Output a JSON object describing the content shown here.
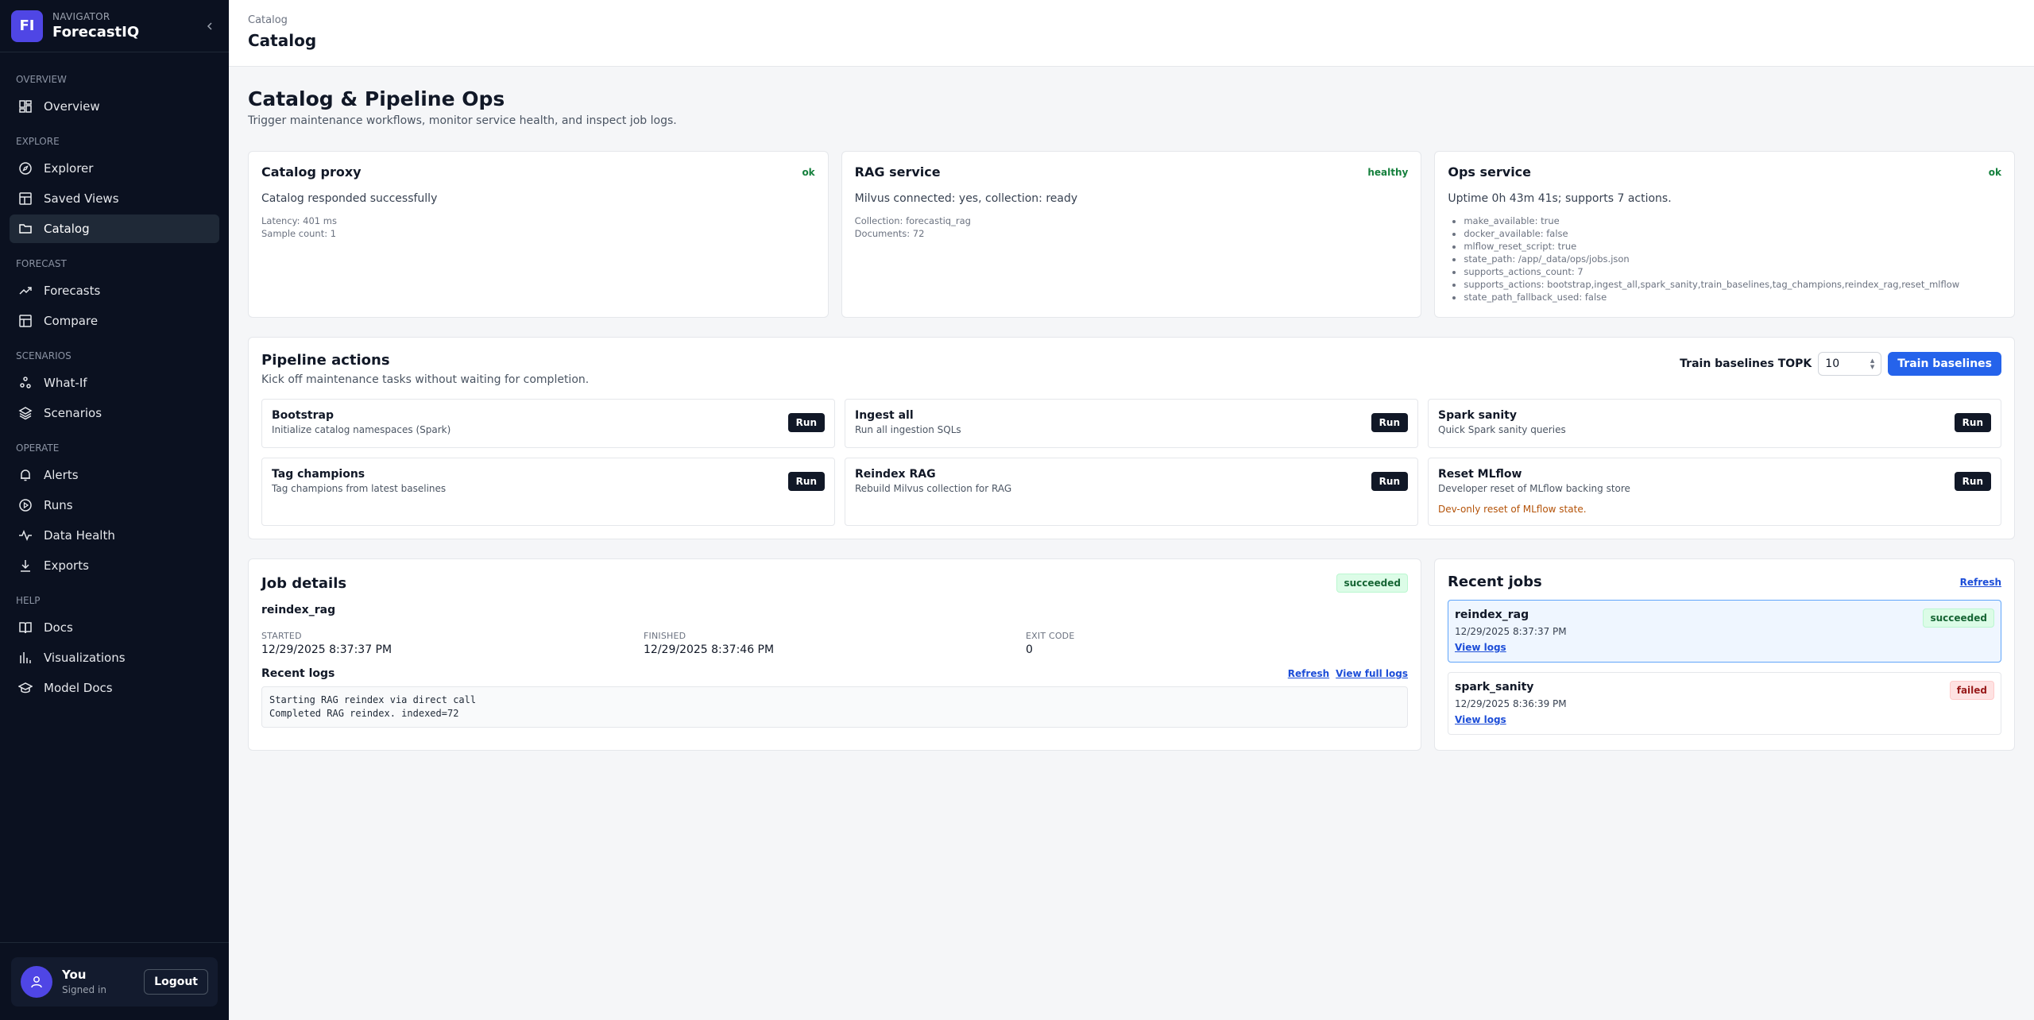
{
  "sidebar": {
    "brand_initials": "FI",
    "brand_sub": "NAVIGATOR",
    "brand_name": "ForecastIQ",
    "sections": {
      "overview": "OVERVIEW",
      "explore": "EXPLORE",
      "forecast": "FORECAST",
      "scenarios": "SCENARIOS",
      "operate": "OPERATE",
      "help": "HELP"
    },
    "items": {
      "overview": "Overview",
      "explorer": "Explorer",
      "saved_views": "Saved Views",
      "catalog": "Catalog",
      "forecasts": "Forecasts",
      "compare": "Compare",
      "what_if": "What-If",
      "scenarios": "Scenarios",
      "alerts": "Alerts",
      "runs": "Runs",
      "data_health": "Data Health",
      "exports": "Exports",
      "docs": "Docs",
      "visualizations": "Visualizations",
      "model_docs": "Model Docs"
    },
    "user": {
      "name": "You",
      "status": "Signed in",
      "logout": "Logout"
    }
  },
  "header": {
    "breadcrumb": "Catalog",
    "title": "Catalog"
  },
  "page": {
    "title": "Catalog & Pipeline Ops",
    "subtitle": "Trigger maintenance workflows, monitor service health, and inspect job logs."
  },
  "services": {
    "catalog": {
      "title": "Catalog proxy",
      "status": "ok",
      "message": "Catalog responded successfully",
      "meta1": "Latency: 401 ms",
      "meta2": "Sample count: 1"
    },
    "rag": {
      "title": "RAG service",
      "status": "healthy",
      "message": "Milvus connected: yes, collection: ready",
      "meta1": "Collection: forecastiq_rag",
      "meta2": "Documents: 72"
    },
    "ops": {
      "title": "Ops service",
      "status": "ok",
      "message": "Uptime 0h 43m 41s; supports 7 actions.",
      "details": [
        "make_available: true",
        "docker_available: false",
        "mlflow_reset_script: true",
        "state_path: /app/_data/ops/jobs.json",
        "supports_actions_count: 7",
        "supports_actions: bootstrap,ingest_all,spark_sanity,train_baselines,tag_champions,reindex_rag,reset_mlflow",
        "state_path_fallback_used: false"
      ]
    }
  },
  "pipeline": {
    "title": "Pipeline actions",
    "subtitle": "Kick off maintenance tasks without waiting for completion.",
    "topk_label": "Train baselines TOPK",
    "topk_value": "10",
    "train_button": "Train baselines",
    "run_label": "Run",
    "actions": {
      "bootstrap": {
        "title": "Bootstrap",
        "desc": "Initialize catalog namespaces (Spark)"
      },
      "ingest": {
        "title": "Ingest all",
        "desc": "Run all ingestion SQLs"
      },
      "spark": {
        "title": "Spark sanity",
        "desc": "Quick Spark sanity queries"
      },
      "tag": {
        "title": "Tag champions",
        "desc": "Tag champions from latest baselines"
      },
      "reindex": {
        "title": "Reindex RAG",
        "desc": "Rebuild Milvus collection for RAG"
      },
      "reset": {
        "title": "Reset MLflow",
        "desc": "Developer reset of MLflow backing store",
        "warning": "Dev-only reset of MLflow state."
      }
    }
  },
  "job_details": {
    "title": "Job details",
    "status": "succeeded",
    "name": "reindex_rag",
    "started_label": "STARTED",
    "started": "12/29/2025 8:37:37 PM",
    "finished_label": "FINISHED",
    "finished": "12/29/2025 8:37:46 PM",
    "exit_label": "EXIT CODE",
    "exit": "0",
    "logs_title": "Recent logs",
    "refresh": "Refresh",
    "view_full": "View full logs",
    "logs": "Starting RAG reindex via direct call\nCompleted RAG reindex. indexed=72"
  },
  "recent_jobs": {
    "title": "Recent jobs",
    "refresh": "Refresh",
    "view_logs": "View logs",
    "jobs": [
      {
        "name": "reindex_rag",
        "time": "12/29/2025 8:37:37 PM",
        "status": "succeeded"
      },
      {
        "name": "spark_sanity",
        "time": "12/29/2025 8:36:39 PM",
        "status": "failed"
      }
    ]
  },
  "colors": {
    "accent": "#2563eb",
    "brand": "#4f46e5",
    "sidebar_bg": "#0b1120",
    "success": "#15803d",
    "danger": "#991b1b",
    "warning": "#b45309"
  }
}
